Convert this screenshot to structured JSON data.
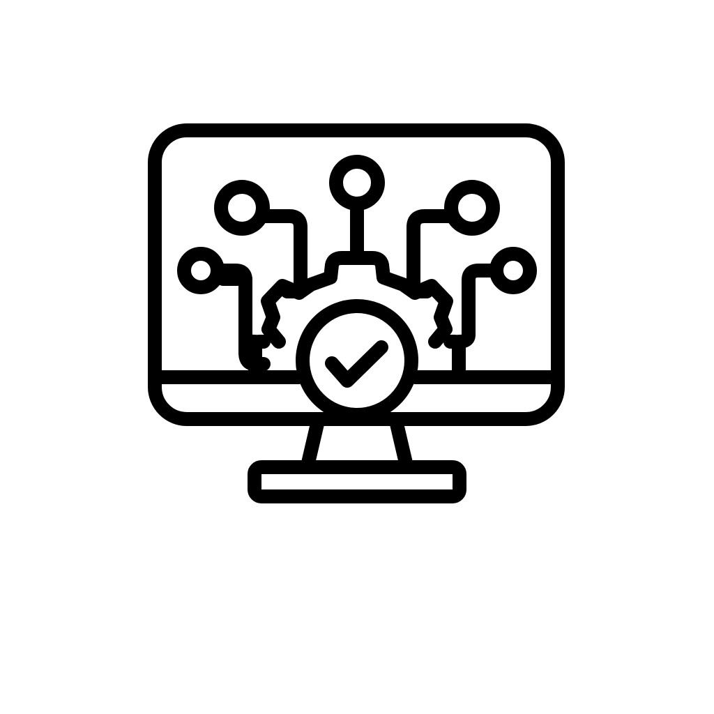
{
  "icon": {
    "name": "monitor-gear-check-icon",
    "depicts": [
      "monitor-icon",
      "gear-icon",
      "check-mark-icon",
      "circuit-node-icon"
    ]
  },
  "colors": {
    "background": "#ffffff",
    "stroke": "#000000"
  }
}
